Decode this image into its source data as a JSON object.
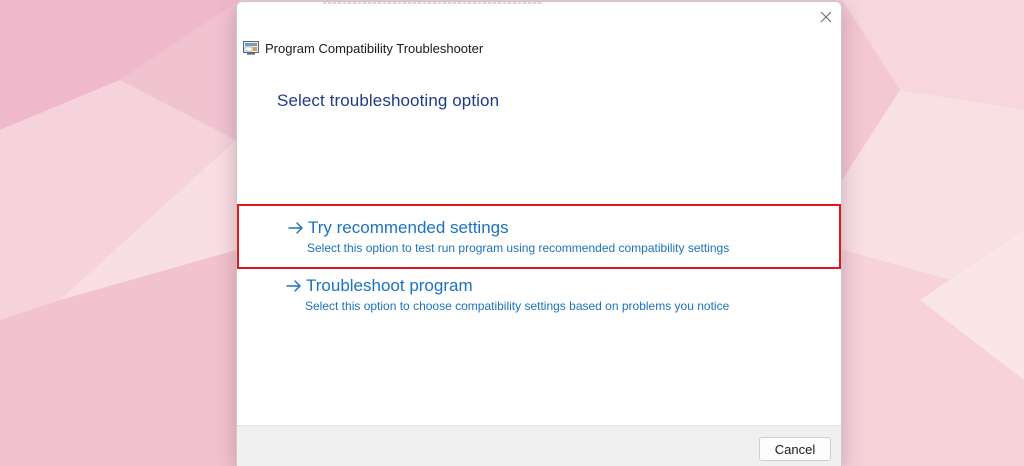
{
  "window": {
    "title": "Program Compatibility Troubleshooter",
    "close_icon": "close-icon",
    "app_icon": "program-compatibility-icon"
  },
  "main": {
    "heading": "Select troubleshooting option",
    "options": [
      {
        "title": "Try recommended settings",
        "description": "Select this option to test run program using recommended compatibility settings",
        "icon": "arrow-right-icon",
        "highlighted": true
      },
      {
        "title": "Troubleshoot program",
        "description": "Select this option to choose compatibility settings based on problems you notice",
        "icon": "arrow-right-icon",
        "highlighted": false
      }
    ]
  },
  "footer": {
    "cancel_label": "Cancel"
  },
  "colors": {
    "heading": "#1f3a8a",
    "link": "#1a73c2",
    "highlight_border": "#e0161b",
    "footer_bg": "#f0f0f0"
  }
}
